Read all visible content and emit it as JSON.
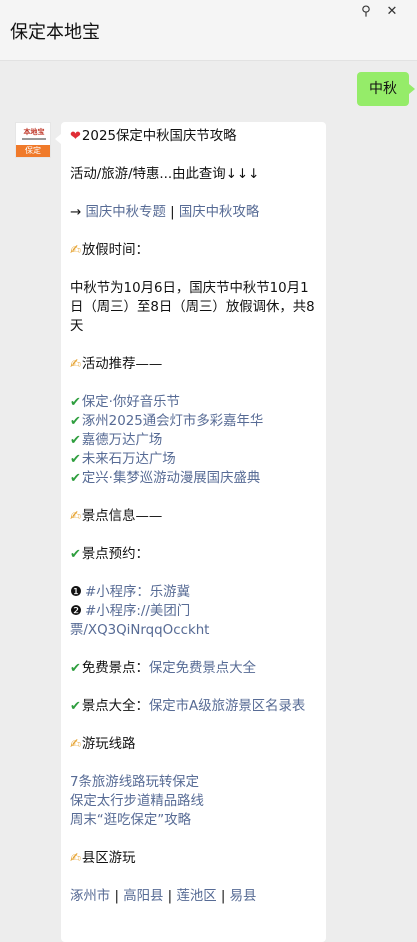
{
  "window": {
    "title": "保定本地宝",
    "pin_icon": "⚲",
    "close_icon": "✕"
  },
  "sent": {
    "text": "中秋"
  },
  "avatar": {
    "logo_text": "本地宝",
    "tag": "保定"
  },
  "article": {
    "headline": "2025保定中秋国庆节攻略",
    "intro": "活动/旅游/特惠...由此查询↓↓↓",
    "arrow": "→",
    "links1": [
      "国庆中秋专题",
      "国庆中秋攻略"
    ],
    "holiday_heading": "放假时间：",
    "holiday_text": "中秋节为10月6日，国庆节中秋节10月1日（周三）至8日（周三）放假调休，共8天",
    "activity_heading": "活动推荐——",
    "activities": [
      "保定·你好音乐节",
      "涿州2025通会灯市多彩嘉年华",
      "嘉德万达广场",
      "未来石万达广场",
      "定兴·集梦巡游动漫展国庆盛典"
    ],
    "spot_heading": "景点信息——",
    "booking_heading": "景点预约：",
    "booking_items": [
      {
        "num": "❶",
        "text": "#小程序：乐游冀"
      },
      {
        "num": "❷",
        "text": "#小程序://美团门票/XQ3QiNrqqOcckht"
      }
    ],
    "free_label": "免费景点：",
    "free_link": "保定免费景点大全",
    "all_label": "景点大全：",
    "all_link": "保定市A级旅游景区名录表",
    "routes_heading": "游玩线路",
    "routes": [
      "7条旅游线路玩转保定",
      "保定太行步道精品路线",
      "周末“逛吃保定”攻略"
    ],
    "county_heading": "县区游玩",
    "counties": [
      "涿州市",
      "高阳县",
      "莲池区",
      "易县"
    ]
  },
  "colors": {
    "link": "#576b95",
    "bubble_green": "#95ec69",
    "check_green": "#2e9e3e",
    "tag_orange": "#f07a2a"
  },
  "icons": {
    "heart": "heart-icon",
    "pen": "writing-hand-icon",
    "check": "check-mark-icon"
  }
}
